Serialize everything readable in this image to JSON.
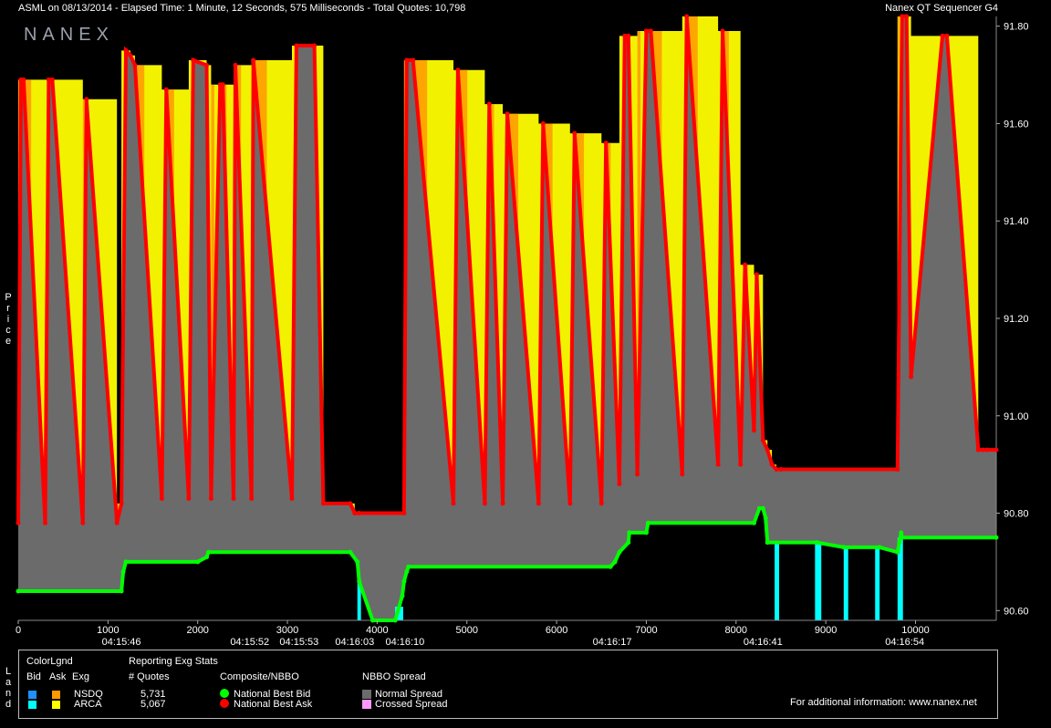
{
  "header": {
    "left": "ASML on 08/13/2014  -  Elapsed Time: 1 Minute, 12 Seconds, 575 Milliseconds  -  Total Quotes: 10,798",
    "right": "Nanex QT Sequencer G4"
  },
  "logo": "NANEX",
  "left_axis_label": [
    "P",
    "r",
    "i",
    "c",
    "e"
  ],
  "land_label": [
    "L",
    "a",
    "n",
    "d"
  ],
  "colors": {
    "bg": "#000000",
    "spread": "#6b6b6b",
    "nsdq_ask": "#ff9900",
    "arca_ask": "#ffff00",
    "nsdq_bid": "#1e90ff",
    "arca_bid": "#00ffff",
    "nbb": "#00ff00",
    "nbo": "#ff0000",
    "crossed": "#ff99ff"
  },
  "legend": {
    "color_lgnd": "ColorLgnd",
    "bid": "Bid",
    "ask": "Ask",
    "exg": "Exg",
    "reporting": "Reporting Exg Stats",
    "num_quotes": "# Quotes",
    "exchanges": [
      {
        "name": "NSDQ",
        "quotes": "5,731"
      },
      {
        "name": "ARCA",
        "quotes": "5,067"
      }
    ],
    "composite": "Composite/NBBO",
    "nbb": "National Best Bid",
    "nbo": "National Best Ask",
    "spread_title": "NBBO Spread",
    "normal": "Normal Spread",
    "crossed": "Crossed Spread",
    "info": "For additional information: www.nanex.net"
  },
  "chart_data": {
    "type": "line",
    "title": "ASML on 08/13/2014",
    "xlabel": "",
    "ylabel": "Price",
    "xlim": [
      0,
      10900
    ],
    "ylim": [
      90.58,
      91.82
    ],
    "x_ticks": [
      0,
      1000,
      2000,
      3000,
      4000,
      5000,
      6000,
      7000,
      8000,
      9000,
      10000
    ],
    "y_ticks": [
      90.6,
      90.8,
      91.0,
      91.2,
      91.4,
      91.6,
      91.8
    ],
    "time_labels": [
      {
        "x": 1150,
        "label": "04:15:46"
      },
      {
        "x": 2580,
        "label": "04:15:52"
      },
      {
        "x": 3130,
        "label": "04:15:53"
      },
      {
        "x": 3750,
        "label": "04:16:03"
      },
      {
        "x": 4310,
        "label": "04:16:10"
      },
      {
        "x": 6620,
        "label": "04:16:17"
      },
      {
        "x": 8300,
        "label": "04:16:41"
      },
      {
        "x": 9880,
        "label": "04:16:54"
      }
    ],
    "series": [
      {
        "name": "National Best Bid",
        "x": [
          0,
          1150,
          1170,
          1200,
          2000,
          2100,
          2120,
          3700,
          3780,
          3800,
          3950,
          4200,
          4280,
          4300,
          4330,
          4350,
          6600,
          6650,
          6700,
          6800,
          6810,
          7000,
          7020,
          8200,
          8260,
          8300,
          8330,
          8350,
          8900,
          9200,
          9600,
          9800,
          9820,
          9840,
          9850,
          10900
        ],
        "y": [
          90.64,
          90.64,
          90.68,
          90.7,
          90.7,
          90.71,
          90.72,
          90.72,
          90.7,
          90.66,
          90.58,
          90.58,
          90.63,
          90.66,
          90.68,
          90.69,
          90.69,
          90.7,
          90.72,
          90.74,
          90.76,
          90.76,
          90.78,
          90.78,
          90.81,
          90.81,
          90.79,
          90.74,
          90.74,
          90.73,
          90.73,
          90.72,
          90.74,
          90.76,
          90.75,
          90.75
        ]
      },
      {
        "name": "National Best Ask",
        "x": [
          0,
          30,
          60,
          300,
          340,
          380,
          720,
          760,
          1100,
          1150,
          1200,
          1250,
          1300,
          1600,
          1650,
          1900,
          1950,
          2100,
          2150,
          2250,
          2280,
          2400,
          2420,
          2600,
          2620,
          3050,
          3100,
          3300,
          3400,
          3700,
          3750,
          3800,
          4300,
          4330,
          4400,
          4850,
          4900,
          5200,
          5250,
          5400,
          5450,
          5800,
          5850,
          6150,
          6200,
          6500,
          6550,
          6700,
          6760,
          6800,
          6900,
          7000,
          7050,
          7400,
          7450,
          7800,
          7850,
          8050,
          8100,
          8200,
          8230,
          8300,
          8350,
          8400,
          8450,
          8500,
          9800,
          9850,
          9900,
          9950,
          10300,
          10350,
          10700,
          10750,
          10800,
          10900
        ],
        "y": [
          90.78,
          91.69,
          91.69,
          90.78,
          91.69,
          91.69,
          90.78,
          91.65,
          90.78,
          90.82,
          91.75,
          91.74,
          91.72,
          90.83,
          91.67,
          90.83,
          91.73,
          91.72,
          90.83,
          91.68,
          91.68,
          90.83,
          91.72,
          90.83,
          91.73,
          90.83,
          91.76,
          91.76,
          90.82,
          90.82,
          90.8,
          90.8,
          90.8,
          91.73,
          91.73,
          90.82,
          91.71,
          90.82,
          91.64,
          90.82,
          91.62,
          90.82,
          91.6,
          90.82,
          91.58,
          90.82,
          91.56,
          90.86,
          91.78,
          91.78,
          90.88,
          91.79,
          91.79,
          90.88,
          91.82,
          90.9,
          91.79,
          90.9,
          91.31,
          90.97,
          91.29,
          90.95,
          90.93,
          90.9,
          90.89,
          90.89,
          90.89,
          91.82,
          91.82,
          91.08,
          91.78,
          91.78,
          90.93,
          90.93,
          90.93,
          90.93
        ]
      }
    ]
  }
}
